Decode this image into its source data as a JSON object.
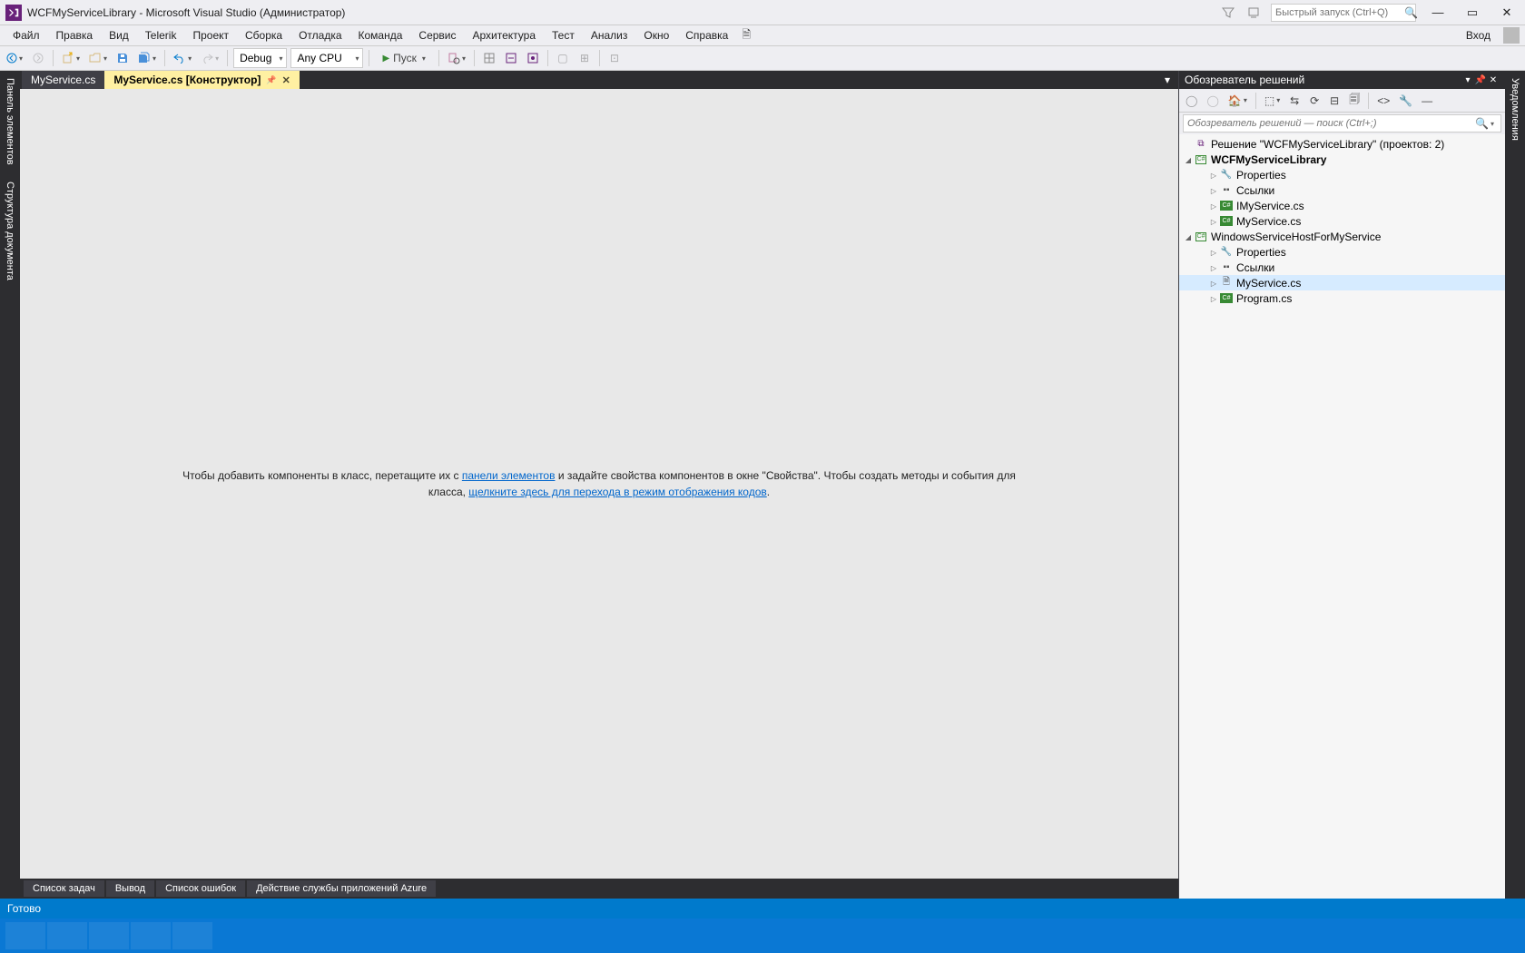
{
  "title": "WCFMyServiceLibrary - Microsoft Visual Studio  (Администратор)",
  "quick_launch_placeholder": "Быстрый запуск (Ctrl+Q)",
  "menu": {
    "items": [
      "Файл",
      "Правка",
      "Вид",
      "Telerik",
      "Проект",
      "Сборка",
      "Отладка",
      "Команда",
      "Сервис",
      "Архитектура",
      "Тест",
      "Анализ",
      "Окно",
      "Справка"
    ],
    "login": "Вход"
  },
  "toolbar": {
    "config": "Debug",
    "platform": "Any CPU",
    "start": "Пуск"
  },
  "sidebars": {
    "left": [
      "Панель элементов",
      "Структура документа"
    ],
    "right": [
      "Уведомления"
    ]
  },
  "tabs": [
    {
      "label": "MyService.cs",
      "active": false
    },
    {
      "label": "MyService.cs [Конструктор]",
      "active": true
    }
  ],
  "designer_msg": {
    "pre1": "Чтобы добавить компоненты в класс, перетащите их с ",
    "link1": "панели элементов",
    "mid1": " и задайте свойства компонентов в окне \"Свойства\". Чтобы создать методы и события для класса, ",
    "link2": "щелкните здесь для перехода в режим отображения кодов",
    "post": "."
  },
  "bottom_tabs": [
    "Список задач",
    "Вывод",
    "Список ошибок",
    "Действие службы приложений Azure"
  ],
  "solution_panel": {
    "title": "Обозреватель решений",
    "search_placeholder": "Обозреватель решений — поиск (Ctrl+;)",
    "solution_label": "Решение \"WCFMyServiceLibrary\"  (проектов: 2)",
    "projects": [
      {
        "name": "WCFMyServiceLibrary",
        "bold": true,
        "items": [
          {
            "type": "props",
            "label": "Properties"
          },
          {
            "type": "refs",
            "label": "Ссылки"
          },
          {
            "type": "cs",
            "label": "IMyService.cs"
          },
          {
            "type": "cs",
            "label": "MyService.cs"
          }
        ]
      },
      {
        "name": "WindowsServiceHostForMyService",
        "bold": false,
        "items": [
          {
            "type": "props",
            "label": "Properties"
          },
          {
            "type": "refs",
            "label": "Ссылки"
          },
          {
            "type": "comp",
            "label": "MyService.cs",
            "selected": true
          },
          {
            "type": "cs",
            "label": "Program.cs"
          }
        ]
      }
    ]
  },
  "status": "Готово"
}
